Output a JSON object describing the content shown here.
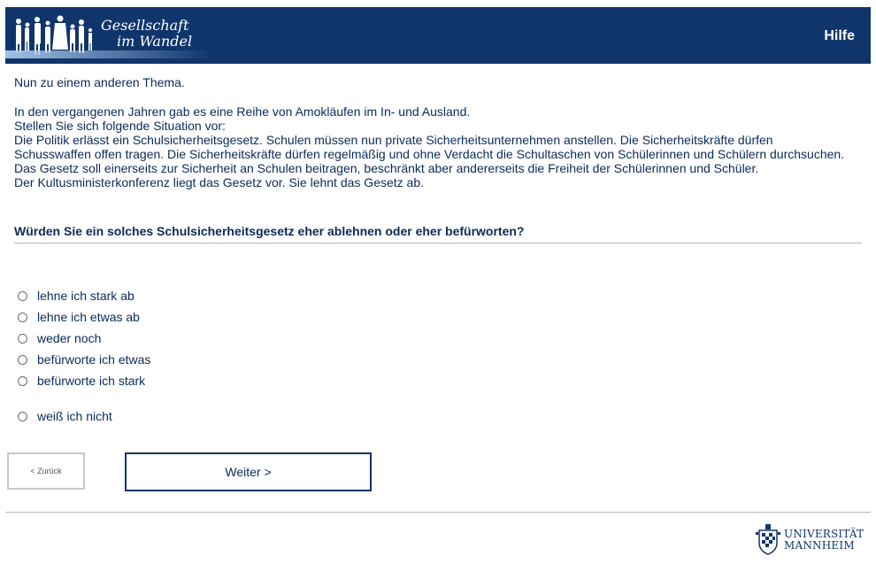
{
  "header": {
    "logo_line1": "Gesellschaft",
    "logo_line2": "im Wandel",
    "help_label": "Hilfe",
    "bg_color": "#10356b"
  },
  "intro": {
    "line1": "Nun zu einem anderen Thema.",
    "paragraph": [
      "In den vergangenen Jahren gab es eine Reihe von Amokläufen im In- und Ausland.",
      "Stellen Sie sich folgende Situation vor:",
      "Die Politik erlässt ein Schulsicherheitsgesetz. Schulen müssen nun private Sicherheitsunternehmen anstellen. Die Sicherheitskräfte dürfen Schusswaffen offen tragen. Die Sicherheitskräfte dürfen regelmäßig und ohne Verdacht die Schultaschen von Schülerinnen und Schülern durchsuchen. Das Gesetz soll einerseits zur Sicherheit an Schulen beitragen, beschränkt aber andererseits die Freiheit der Schülerinnen und Schüler.",
      "Der Kultusministerkonferenz liegt das Gesetz vor. Sie lehnt das Gesetz ab."
    ]
  },
  "question": "Würden Sie ein solches Schulsicherheitsgesetz eher ablehnen oder eher befürworten?",
  "options": [
    "lehne ich stark ab",
    "lehne ich etwas ab",
    "weder noch",
    "befürworte ich etwas",
    "befürworte ich stark",
    "weiß ich nicht"
  ],
  "nav": {
    "back_label": "< Zurück",
    "next_label": "Weiter >"
  },
  "footer": {
    "uni_line1": "UNIVERSITÄT",
    "uni_line2": "MANNHEIM"
  }
}
